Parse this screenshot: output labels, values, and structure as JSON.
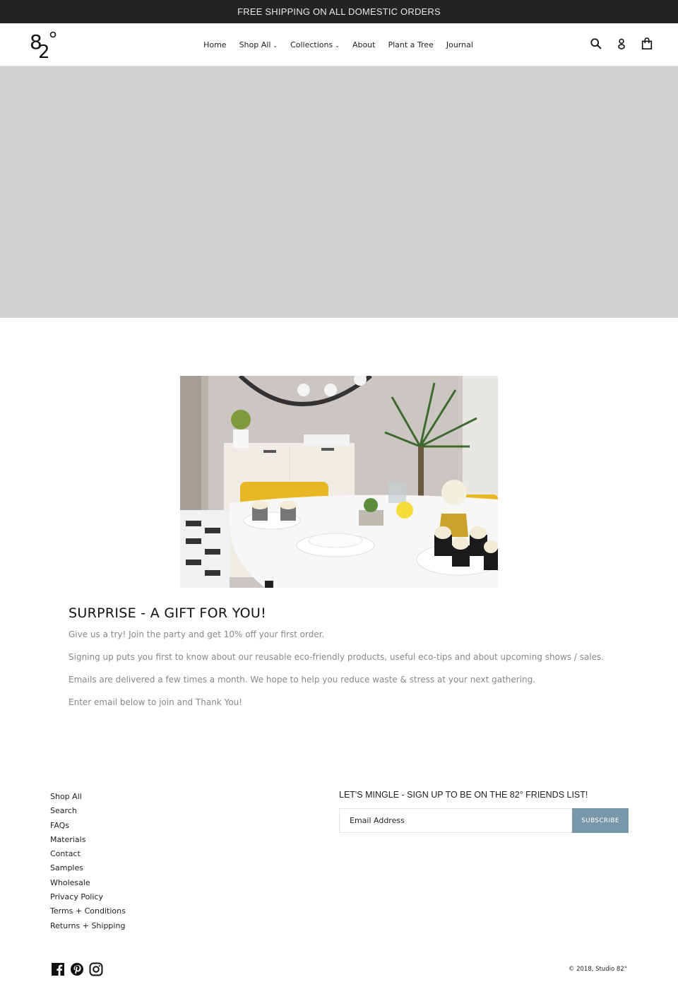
{
  "announcement": {
    "text": "FREE SHIPPING ON ALL DOMESTIC ORDERS"
  },
  "header": {
    "logo_text": "82°",
    "nav": [
      {
        "label": "Home",
        "has_dropdown": false
      },
      {
        "label": "Shop All",
        "has_dropdown": true
      },
      {
        "label": "Collections",
        "has_dropdown": true
      },
      {
        "label": "About",
        "has_dropdown": false
      },
      {
        "label": "Plant a Tree",
        "has_dropdown": false
      },
      {
        "label": "Journal",
        "has_dropdown": false
      }
    ],
    "icons": [
      "search-icon",
      "account-icon",
      "cart-icon"
    ]
  },
  "hero": {
    "placeholder_color": "#d0d1d3"
  },
  "feature_image": {
    "alt": "Party table setting with yellow chairs, cupcakes and plants"
  },
  "promo": {
    "title": "SURPRISE - A GIFT FOR YOU!",
    "paragraphs": [
      "Give us a try! Join the party and get 10% off your first order.",
      "Signing up puts you first to know about our reusable eco-friendly products, useful eco-tips and about upcoming shows / sales.",
      "Emails are delivered a few times a month. We hope to help you reduce waste & stress at your next gathering.",
      "Enter email below to join and Thank You!"
    ]
  },
  "footer": {
    "links": [
      "Shop All",
      "Search",
      "FAQs",
      "Materials",
      "Contact",
      "Samples",
      "Wholesale",
      "Privacy Policy",
      "Terms + Conditions",
      "Returns + Shipping"
    ],
    "newsletter": {
      "title": "LET'S MINGLE - SIGN UP TO BE ON THE 82° FRIENDS LIST!",
      "placeholder": "Email Address",
      "button_label": "SUBSCRIBE",
      "button_color": "#7897a8"
    },
    "social": [
      "facebook-icon",
      "pinterest-icon",
      "instagram-icon"
    ],
    "copyright": "© 2018, Studio 82°"
  },
  "colors": {
    "announcement_bg": "#232323",
    "accent": "#7897a8"
  }
}
